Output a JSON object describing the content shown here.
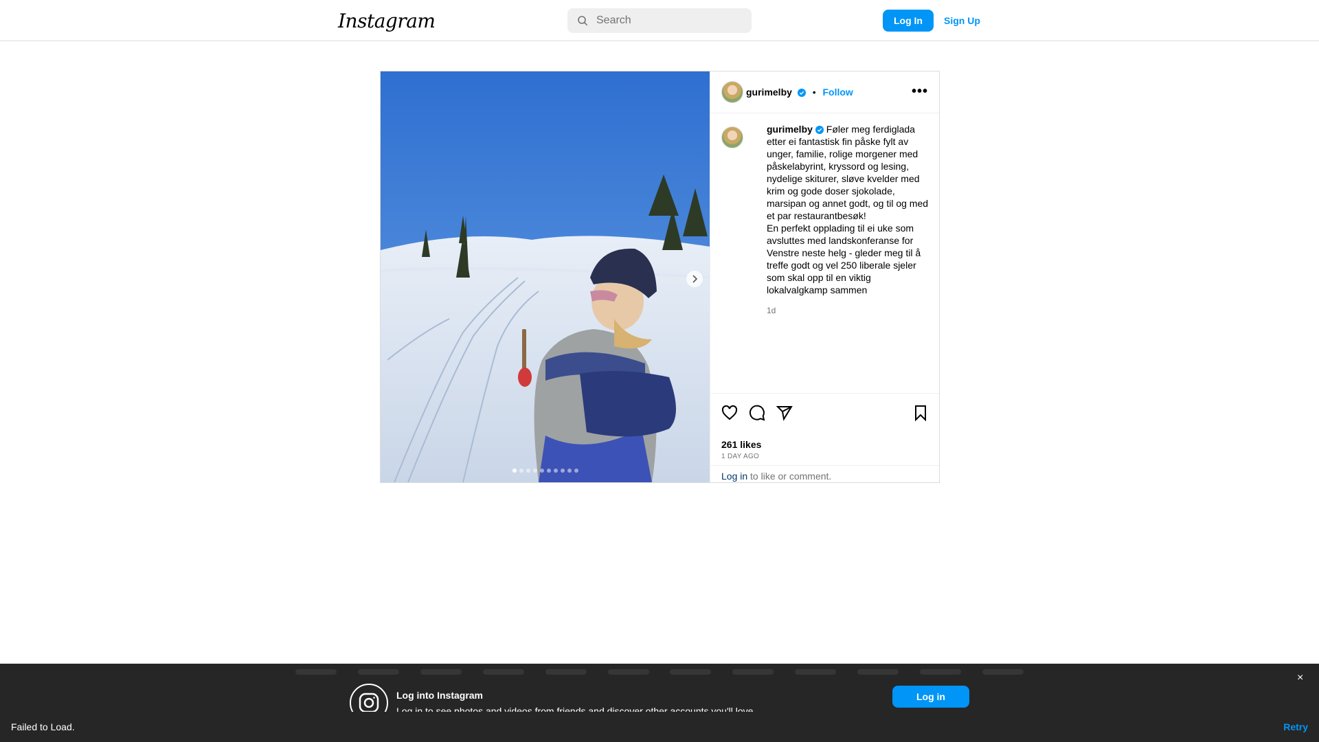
{
  "header": {
    "logo_text": "Instagram",
    "search_placeholder": "Search",
    "login_label": "Log In",
    "signup_label": "Sign Up"
  },
  "post": {
    "username": "gurimelby",
    "follow_label": "Follow",
    "dot": "•",
    "more": "•••",
    "caption": "Føler meg ferdiglada etter ei fantastisk fin påske fylt av unger, familie, rolige morgener med påskelabyrint, kryssord og lesing, nydelige skiturer, sløve kvelder med krim og gode doser sjokolade, marsipan og annet godt, og til og med et par restaurantbesøk! \nEn perfekt opplading til ei uke som avsluttes med landskonferanse for Venstre neste helg - gleder meg til å treffe godt og vel 250 liberale sjeler som skal opp til en viktig lokalvalgkamp sammen ",
    "caption_time": "1d",
    "likes": "261 likes",
    "time_ago": "1 DAY AGO",
    "login_link": "Log in",
    "login_rest": " to like or comment.",
    "carousel_total": 10,
    "carousel_current": 1
  },
  "banner": {
    "title": "Log into Instagram",
    "subtitle": "Log in to see photos and videos from friends and discover other accounts you'll love.",
    "login_label": "Log in",
    "close": "×"
  },
  "error_bar": {
    "message": "Failed to Load.",
    "retry_label": "Retry"
  },
  "colors": {
    "accent": "#0095f6",
    "dark_bar": "#262626",
    "border": "#dbdbdb"
  }
}
